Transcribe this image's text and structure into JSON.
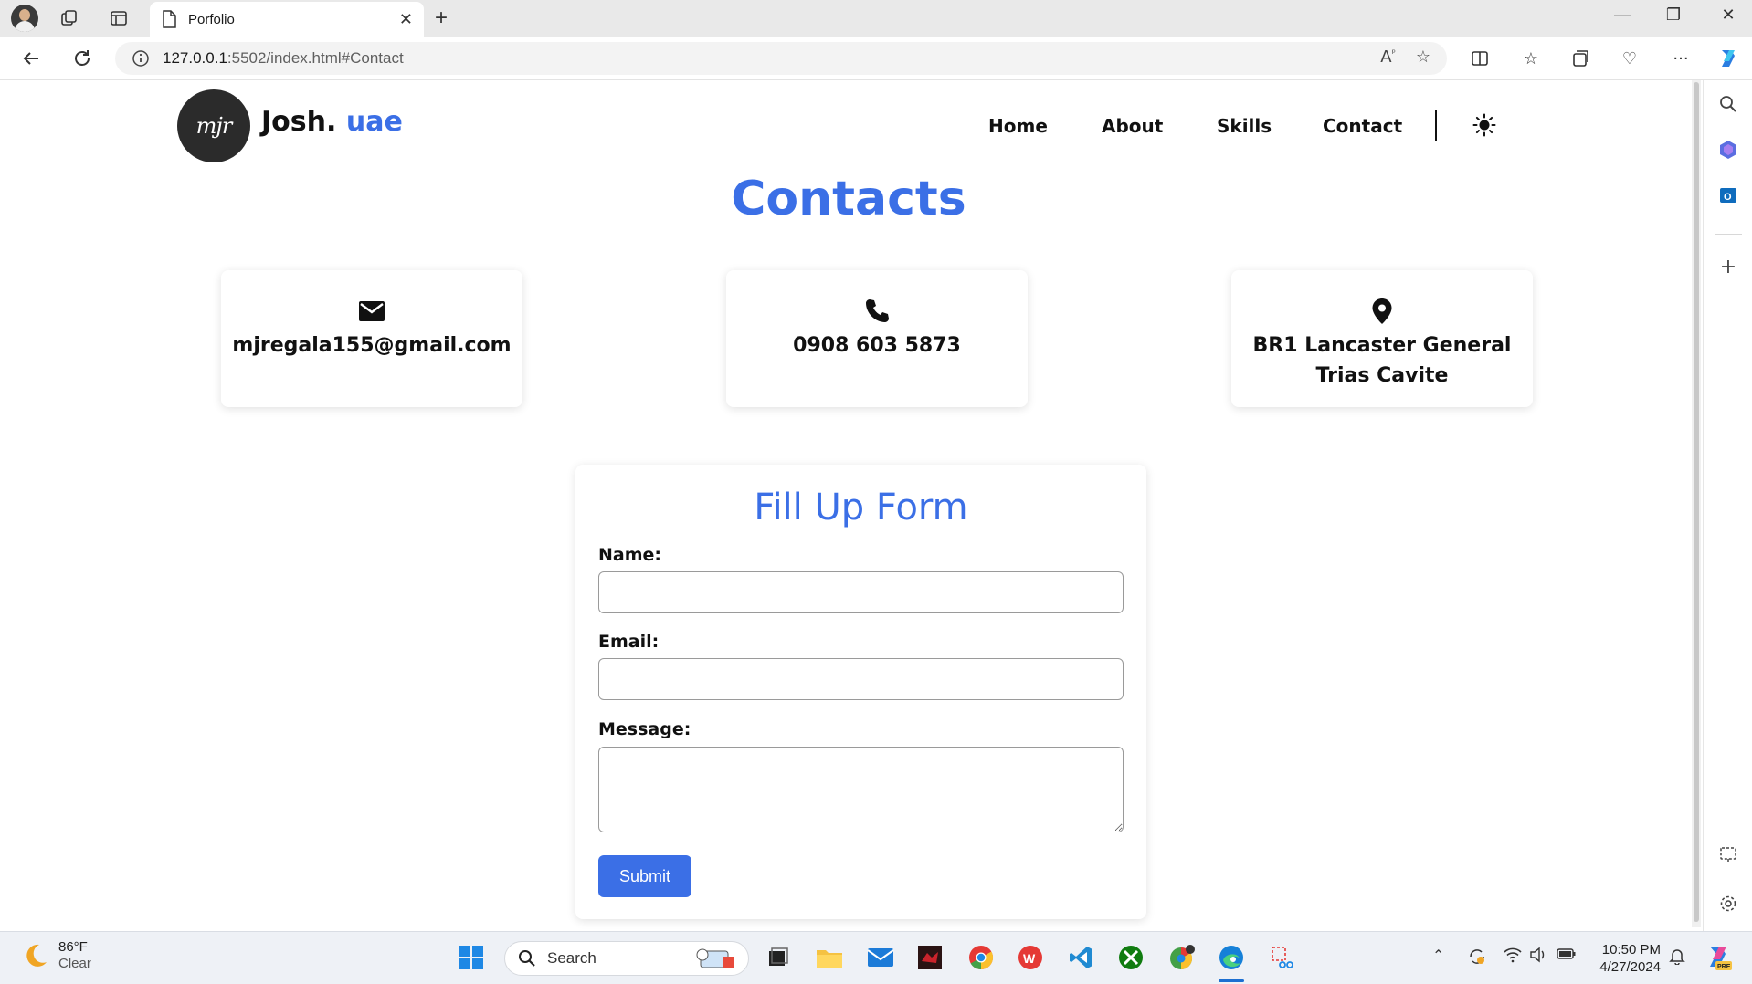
{
  "browser": {
    "tab_title": "Porfolio",
    "url_host": "127.0.0.1",
    "url_rest": ":5502/index.html#Contact"
  },
  "site": {
    "brand_main": "Josh.",
    "brand_accent": "uae",
    "logo_text": "mjr",
    "accent_color": "#3b6fe6",
    "nav": [
      {
        "label": "Home"
      },
      {
        "label": "About"
      },
      {
        "label": "Skills"
      },
      {
        "label": "Contact"
      }
    ]
  },
  "contacts": {
    "title": "Contacts",
    "email": "mjregala155@gmail.com",
    "phone": "0908 603 5873",
    "address_line1": "BR1 Lancaster General",
    "address_line2": "Trias Cavite"
  },
  "form": {
    "title": "Fill Up Form",
    "name_label": "Name:",
    "email_label": "Email:",
    "message_label": "Message:",
    "submit_label": "Submit"
  },
  "taskbar": {
    "temperature": "86°F",
    "condition": "Clear",
    "search_placeholder": "Search",
    "time": "10:50 PM",
    "date": "4/27/2024"
  }
}
